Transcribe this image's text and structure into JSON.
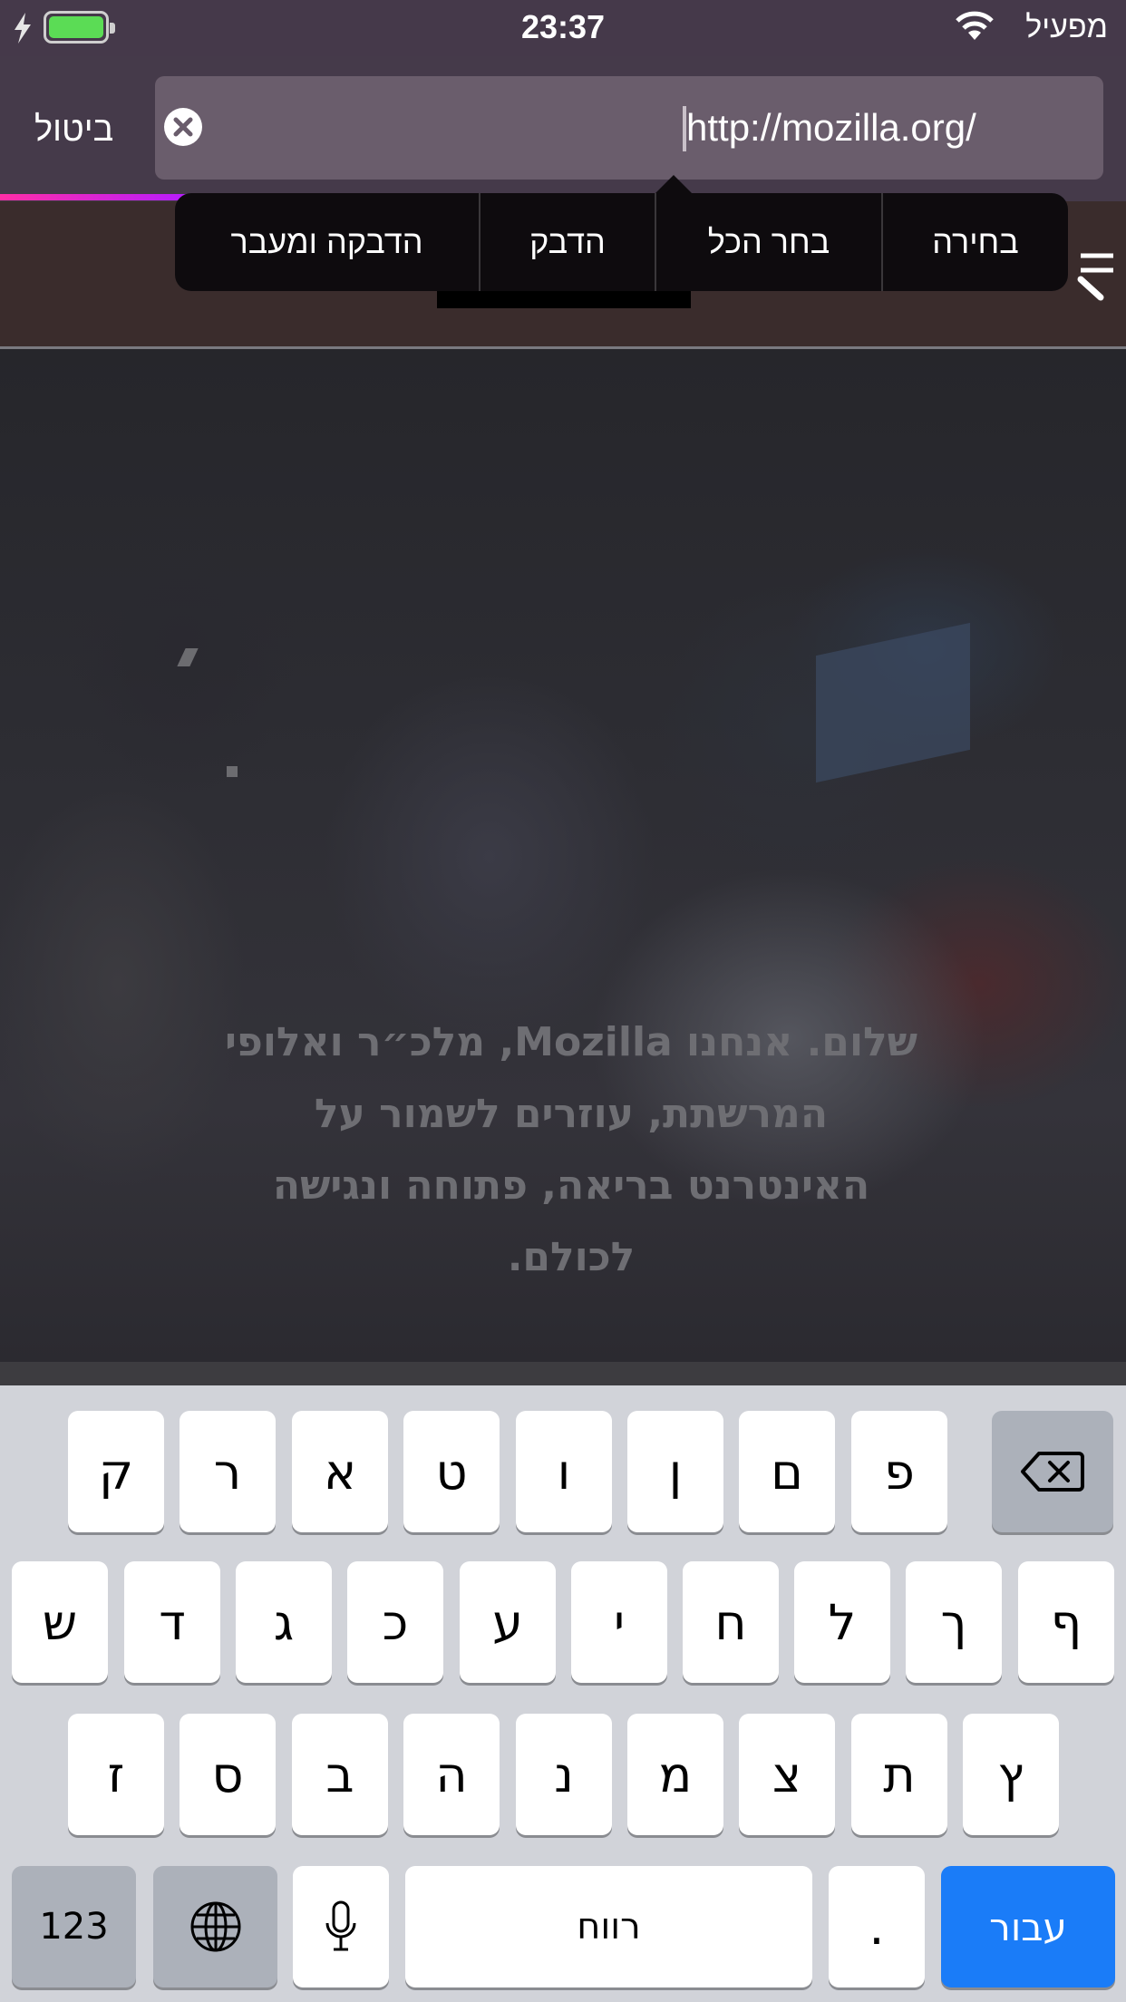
{
  "status": {
    "time": "23:37",
    "carrier": "מפעיל"
  },
  "urlbar": {
    "cancel": "ביטול",
    "url": "http://mozilla.org/"
  },
  "edit_menu": [
    "בחירה",
    "בחר הכל",
    "הדבק",
    "הדבקה ומעבר"
  ],
  "hero": {
    "lines": [
      "שלום. אנחנו Mozilla, מלכ״ר ואלופי",
      "המרשתת, עוזרים לשמור על",
      "האינטרנט בריאה, פתוחה ונגישה",
      "לכולם."
    ]
  },
  "keyboard": {
    "row1": [
      "ק",
      "ר",
      "א",
      "ט",
      "ו",
      "ן",
      "ם",
      "פ"
    ],
    "row2": [
      "ש",
      "ד",
      "ג",
      "כ",
      "ע",
      "י",
      "ח",
      "ל",
      "ך",
      "ף"
    ],
    "row3": [
      "ז",
      "ס",
      "ב",
      "ה",
      "נ",
      "מ",
      "צ",
      "ת",
      "ץ"
    ],
    "numbers": "123",
    "space": "רווח",
    "period": ".",
    "go": "עבור"
  }
}
